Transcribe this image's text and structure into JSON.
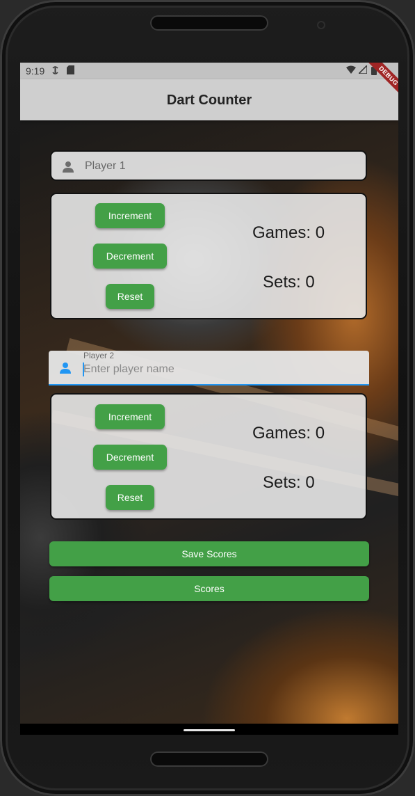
{
  "status_bar": {
    "time": "9:19",
    "icons": [
      "sync-icon",
      "sd-card-icon",
      "wifi-icon",
      "signal-icon",
      "battery-icon"
    ]
  },
  "app_bar": {
    "title": "Dart Counter",
    "debug_banner": "DEBUG"
  },
  "player1": {
    "name_value": "Player 1",
    "games_text": "Games: 0",
    "sets_text": "Sets: 0",
    "increment_label": "Increment",
    "decrement_label": "Decrement",
    "reset_label": "Reset"
  },
  "player2": {
    "field_label": "Player 2",
    "placeholder": "Enter player name",
    "games_text": "Games: 0",
    "sets_text": "Sets: 0",
    "increment_label": "Increment",
    "decrement_label": "Decrement",
    "reset_label": "Reset"
  },
  "actions": {
    "save_scores_label": "Save Scores",
    "scores_label": "Scores"
  },
  "colors": {
    "button_green": "#43a047",
    "focus_blue": "#2196f3",
    "app_bar": "#cfcfcf"
  }
}
